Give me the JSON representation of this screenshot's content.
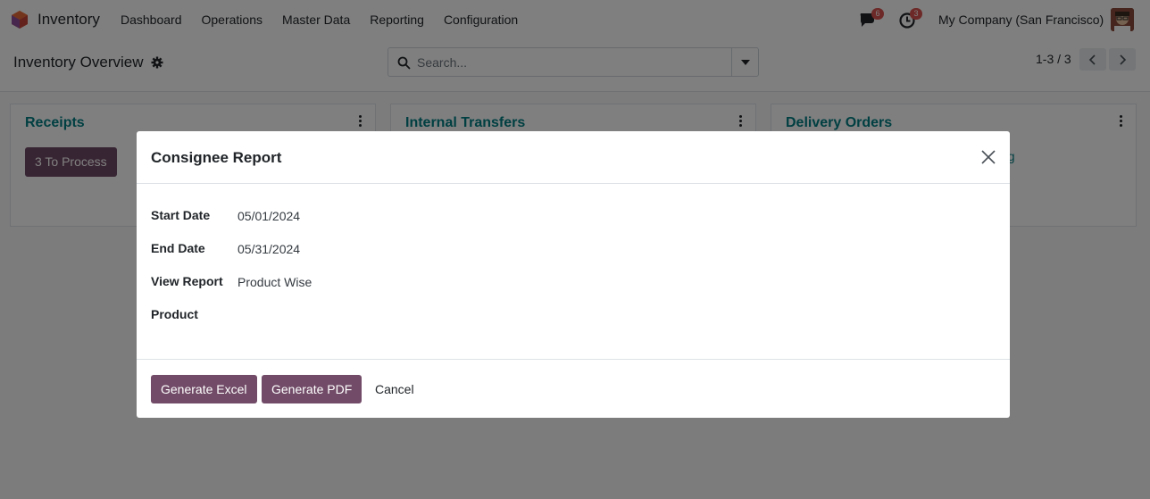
{
  "navbar": {
    "app_name": "Inventory",
    "menu": [
      "Dashboard",
      "Operations",
      "Master Data",
      "Reporting",
      "Configuration"
    ],
    "messages_badge": "6",
    "activities_badge": "3",
    "company": "My Company (San Francisco)"
  },
  "control_panel": {
    "breadcrumb": "Inventory Overview",
    "search_placeholder": "Search...",
    "pager": "1-3 / 3"
  },
  "cards": [
    {
      "title": "Receipts",
      "button": "3 To Process"
    },
    {
      "title": "Internal Transfers"
    },
    {
      "title": "Delivery Orders",
      "partial_text": "ng"
    }
  ],
  "dialog": {
    "title": "Consignee Report",
    "fields": [
      {
        "label": "Start Date",
        "value": "05/01/2024"
      },
      {
        "label": "End Date",
        "value": "05/31/2024"
      },
      {
        "label": "View Report",
        "value": "Product Wise"
      },
      {
        "label": "Product",
        "value": ""
      }
    ],
    "buttons": {
      "generate_excel": "Generate Excel",
      "generate_pdf": "Generate PDF",
      "cancel": "Cancel"
    }
  },
  "colors": {
    "brand_primary": "#714b67",
    "card_title": "#017e84",
    "badge": "#d9534f"
  },
  "icons": [
    "inventory-app-icon",
    "chat-icon",
    "clock-icon",
    "gear-icon",
    "search-icon",
    "chevron-left-icon",
    "chevron-right-icon",
    "close-icon",
    "kebab-icon"
  ]
}
